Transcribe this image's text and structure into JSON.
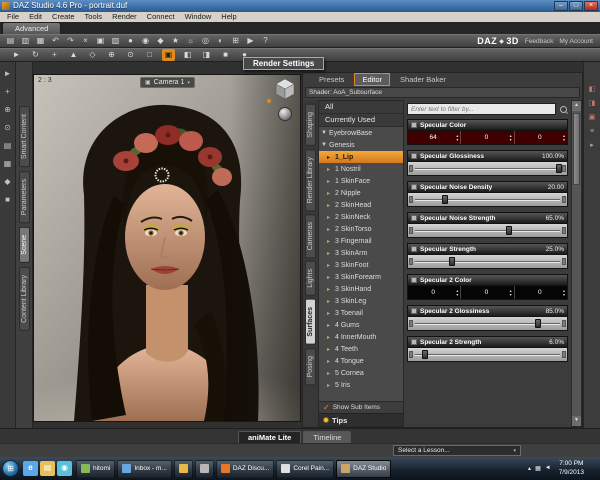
{
  "window": {
    "title": "DAZ Studio 4.6 Pro - portrait.duf",
    "menus": [
      "File",
      "Edit",
      "Create",
      "Tools",
      "Render",
      "Connect",
      "Window",
      "Help"
    ],
    "mode_tab": "Advanced",
    "brand_daz": "DAZ",
    "brand_3d": "3D",
    "link_feedback": "Feedback",
    "link_account": "My Account",
    "controls": {
      "minimize": "–",
      "maximize": "□",
      "close": "×"
    }
  },
  "glyphs": {
    "brand_diamond": "◆",
    "dropdown_arrow": "▾",
    "camera": "▣",
    "check": "✓",
    "scroll_up": "▲",
    "scroll_down": "▼",
    "spinner_up": "▴",
    "spinner_down": "▾",
    "expander_open": "▼",
    "expander_closed": "▸"
  },
  "toolbars": {
    "main_icons": [
      {
        "name": "new-scene-icon",
        "glyph": "▤"
      },
      {
        "name": "open-scene-icon",
        "glyph": "▥"
      },
      {
        "name": "save-scene-icon",
        "glyph": "▦"
      },
      {
        "name": "undo-icon",
        "glyph": "↶"
      },
      {
        "name": "redo-icon",
        "glyph": "↷"
      },
      {
        "name": "cut-icon",
        "glyph": "×"
      },
      {
        "name": "copy-icon",
        "glyph": "▣"
      },
      {
        "name": "paste-icon",
        "glyph": "▧"
      },
      {
        "name": "figure-icon",
        "glyph": "●"
      },
      {
        "name": "hair-icon",
        "glyph": "◉"
      },
      {
        "name": "wardrobe-icon",
        "glyph": "◆"
      },
      {
        "name": "pose-icon",
        "glyph": "★"
      },
      {
        "name": "light-icon",
        "glyph": "☼"
      },
      {
        "name": "camera-icon",
        "glyph": "◎"
      },
      {
        "name": "render-icon",
        "glyph": "◐"
      },
      {
        "name": "frame-icon",
        "glyph": "⊞"
      },
      {
        "name": "play-icon",
        "glyph": "▶"
      },
      {
        "name": "help-icon",
        "glyph": "?"
      }
    ],
    "tool_icons": [
      {
        "name": "scene-navigator-tool-icon",
        "glyph": "►"
      },
      {
        "name": "rotate-tool-icon",
        "glyph": "↻"
      },
      {
        "name": "translate-tool-icon",
        "glyph": "+"
      },
      {
        "name": "scale-tool-icon",
        "glyph": "▲"
      },
      {
        "name": "active-pose-tool-icon",
        "glyph": "◇"
      },
      {
        "name": "powerpose-tool-icon",
        "glyph": "⊕"
      },
      {
        "name": "joint-editor-tool-icon",
        "glyph": "⊙"
      },
      {
        "name": "node-selection-tool-icon",
        "glyph": "□"
      },
      {
        "name": "surface-selection-tool-icon",
        "glyph": "▣"
      },
      {
        "name": "spot-render-tool-icon",
        "glyph": "◧"
      },
      {
        "name": "region-navigator-tool-icon",
        "glyph": "◨"
      },
      {
        "name": "primitive-tool-icon",
        "glyph": "■"
      },
      {
        "name": "view-tool-icon",
        "glyph": "●"
      }
    ],
    "active_tool": "surface-selection-tool-icon"
  },
  "tooltip_text": "Render Settings",
  "left_toolstrip_icons": [
    {
      "name": "pointer-tool-icon",
      "glyph": "►"
    },
    {
      "name": "pan-tool-icon",
      "glyph": "+"
    },
    {
      "name": "orbit-tool-icon",
      "glyph": "⊕"
    },
    {
      "name": "zoom-tool-icon",
      "glyph": "⊙"
    },
    {
      "name": "content-folder-icon",
      "glyph": "▤"
    },
    {
      "name": "save-icon",
      "glyph": "▦"
    },
    {
      "name": "render-icon",
      "glyph": "◆"
    },
    {
      "name": "settings-icon",
      "glyph": "■"
    }
  ],
  "left_dock": {
    "tabs": [
      "Smart Content",
      "Parameters",
      "Scene",
      "Content Library"
    ],
    "active": "Scene"
  },
  "viewport": {
    "aspect_ratio": "2 : 3",
    "camera_name": "Camera 1"
  },
  "right_panel": {
    "tabs": [
      "Presets",
      "Editor",
      "Shader Baker"
    ],
    "active_tab": "Editor",
    "shader_label": "Shader: AoA_Subsurface",
    "side_tabs": [
      "Shaping",
      "Render Library",
      "Cameras",
      "Lights",
      "Surfaces",
      "Posing"
    ],
    "active_side_tab": "Surfaces",
    "search_placeholder": "Enter text to filter by...",
    "surface_tree": {
      "filters": [
        "All",
        "Currently Used"
      ],
      "rows": [
        {
          "kind": "group",
          "label": "EyebrowBase"
        },
        {
          "kind": "group",
          "label": "Genesis"
        },
        {
          "kind": "item",
          "label": "1_Lip",
          "selected": true
        },
        {
          "kind": "item",
          "label": "1 Nostril"
        },
        {
          "kind": "item",
          "label": "1 SkinFace"
        },
        {
          "kind": "item",
          "label": "2 Nipple"
        },
        {
          "kind": "item",
          "label": "2 SkinHead"
        },
        {
          "kind": "item",
          "label": "2 SkinNeck"
        },
        {
          "kind": "item",
          "label": "2 SkinTorso"
        },
        {
          "kind": "item",
          "label": "3 Fingernail"
        },
        {
          "kind": "item",
          "label": "3 SkinArm"
        },
        {
          "kind": "item",
          "label": "3 SkinFoot"
        },
        {
          "kind": "item",
          "label": "3 SkinForearm"
        },
        {
          "kind": "item",
          "label": "3 SkinHand"
        },
        {
          "kind": "item",
          "label": "3 SkinLeg"
        },
        {
          "kind": "item",
          "label": "3 Toenail"
        },
        {
          "kind": "item",
          "label": "4 Gums"
        },
        {
          "kind": "item",
          "label": "4 InnerMouth"
        },
        {
          "kind": "item",
          "label": "4 Teeth"
        },
        {
          "kind": "item",
          "label": "4 Tongue"
        },
        {
          "kind": "item",
          "label": "5 Cornea"
        },
        {
          "kind": "item",
          "label": "5 Iris"
        }
      ],
      "show_sub_items_label": "Show Sub Items",
      "show_sub_items_checked": true,
      "tips_label": "Tips"
    },
    "properties": [
      {
        "name": "Specular Color",
        "type": "color",
        "channel_values": [
          "64",
          "0",
          "0"
        ],
        "swatch_color": "#400000"
      },
      {
        "name": "Specular Glossiness",
        "type": "slider",
        "value": "100.0%",
        "pct": 100
      },
      {
        "name": "Specular Noise Density",
        "type": "slider",
        "value": "20.00",
        "pct": 20
      },
      {
        "name": "Specular Noise Strength",
        "type": "slider",
        "value": "65.0%",
        "pct": 65
      },
      {
        "name": "Specular Strength",
        "type": "slider",
        "value": "25.0%",
        "pct": 25
      },
      {
        "name": "Specular 2 Color",
        "type": "color",
        "channel_values": [
          "0",
          "0",
          "0"
        ],
        "swatch_color": "#050505"
      },
      {
        "name": "Specular 2 Glossiness",
        "type": "slider",
        "value": "85.0%",
        "pct": 85
      },
      {
        "name": "Specular 2 Strength",
        "type": "slider",
        "value": "6.0%",
        "pct": 6
      }
    ]
  },
  "far_strip_icons": [
    {
      "name": "dock-pane-icon-1",
      "glyph": "◧",
      "red": true
    },
    {
      "name": "dock-pane-icon-2",
      "glyph": "◨",
      "red": true
    },
    {
      "name": "dock-pane-icon-3",
      "glyph": "▣",
      "red": true
    },
    {
      "name": "pane-options-icon",
      "glyph": "≡",
      "red": false
    },
    {
      "name": "pane-collapse-icon",
      "glyph": "▸",
      "red": false
    }
  ],
  "bottom_bar": {
    "tab_animate": "aniMate Lite",
    "tab_timeline": "Timeline",
    "lesson_dropdown": "Select a Lesson..."
  },
  "taskbar": {
    "start_glyph": "⊞",
    "quick_icons": [
      {
        "name": "internet-explorer-icon",
        "glyph": "e",
        "color": "#5aa8e8"
      },
      {
        "name": "explorer-icon",
        "glyph": "▤",
        "color": "#e8c05a"
      },
      {
        "name": "media-player-icon",
        "glyph": "◉",
        "color": "#58c0d8"
      }
    ],
    "buttons": [
      {
        "label": "hitomi",
        "icon_color": "#88b858"
      },
      {
        "label": "Inbox - m...",
        "icon_color": "#68a8e0"
      },
      {
        "label": "",
        "icon_color": "#e8b848"
      },
      {
        "label": "",
        "icon_color": "#b8b8b8"
      },
      {
        "label": "DAZ Discu...",
        "icon_color": "#e87828"
      },
      {
        "label": "Corel Pain...",
        "icon_color": "#e0e0e0"
      },
      {
        "label": "DAZ Studio",
        "icon_color": "#caa668",
        "active": true
      }
    ],
    "tray_icons": [
      {
        "name": "hidden-icons-icon",
        "glyph": "▴"
      },
      {
        "name": "network-icon",
        "glyph": "▦"
      },
      {
        "name": "volume-icon",
        "glyph": "◄"
      }
    ],
    "clock_time": "7:00 PM",
    "clock_date": "7/9/2013"
  }
}
